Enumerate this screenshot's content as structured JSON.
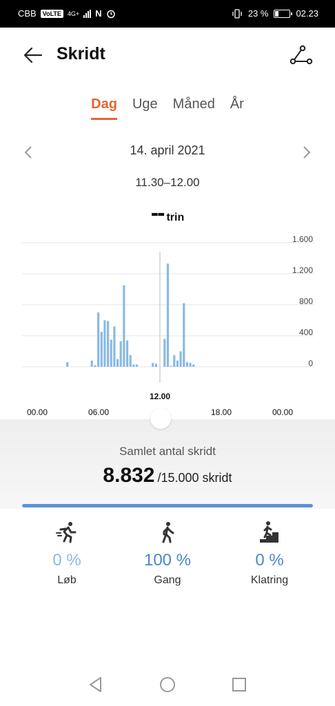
{
  "status_bar": {
    "carrier": "CBB",
    "volte": "VoLTE",
    "network": "4G+",
    "nfc": "N",
    "battery_pct": "23 %",
    "time": "02.23"
  },
  "header": {
    "title": "Skridt",
    "back_icon": "arrow-left-icon",
    "share_icon": "share-nodes-icon"
  },
  "tabs": [
    {
      "label": "Dag",
      "active": true
    },
    {
      "label": "Uge",
      "active": false
    },
    {
      "label": "Måned",
      "active": false
    },
    {
      "label": "År",
      "active": false
    }
  ],
  "date": "14. april 2021",
  "time_range": "11.30–12.00",
  "selected_steps": "--",
  "steps_unit": "trin",
  "chart_data": {
    "type": "bar",
    "x_ticks": [
      "00.00",
      "06.00",
      "18.00",
      "00.00"
    ],
    "selected_tick": "12.00",
    "y_ticks": [
      "1.600",
      "1.200",
      "800",
      "400",
      "0"
    ],
    "ylim": [
      0,
      1600
    ],
    "bar_color": "#8ab9e6",
    "x_hours": [
      2.5,
      4.0,
      4.3,
      4.6,
      4.9,
      5.2,
      5.5,
      5.8,
      6.1,
      6.4,
      6.7,
      7.0,
      7.3,
      7.6,
      8.0,
      8.4,
      8.8,
      9.2,
      9.6,
      10.0,
      10.3,
      10.6,
      11.0,
      11.4,
      11.8,
      12.2,
      12.6,
      13.0,
      13.4,
      13.8,
      14.2,
      14.6,
      15.0,
      15.4,
      15.8,
      16.2,
      16.6,
      17.0,
      17.4,
      17.8,
      18.2,
      18.6,
      19.0
    ],
    "values": [
      60,
      0,
      0,
      0,
      0,
      0,
      0,
      0,
      0,
      0,
      0,
      0,
      0,
      0,
      80,
      20,
      700,
      450,
      600,
      590,
      350,
      520,
      100,
      330,
      1050,
      340,
      150,
      30,
      30,
      0,
      0,
      0,
      50,
      40,
      0,
      360,
      1330,
      10,
      150,
      80,
      200,
      820,
      60
    ],
    "bars": [
      {
        "h": 3.2,
        "v": 60
      },
      {
        "h": 5.5,
        "v": 80
      },
      {
        "h": 5.8,
        "v": 20
      },
      {
        "h": 6.1,
        "v": 700
      },
      {
        "h": 6.4,
        "v": 450
      },
      {
        "h": 6.7,
        "v": 600
      },
      {
        "h": 7.0,
        "v": 590
      },
      {
        "h": 7.3,
        "v": 350
      },
      {
        "h": 7.6,
        "v": 520
      },
      {
        "h": 7.9,
        "v": 100
      },
      {
        "h": 8.2,
        "v": 330
      },
      {
        "h": 8.5,
        "v": 1050
      },
      {
        "h": 8.8,
        "v": 340
      },
      {
        "h": 9.1,
        "v": 150
      },
      {
        "h": 9.4,
        "v": 30
      },
      {
        "h": 9.7,
        "v": 30
      },
      {
        "h": 11.2,
        "v": 50
      },
      {
        "h": 11.5,
        "v": 40
      },
      {
        "h": 12.3,
        "v": 360
      },
      {
        "h": 12.6,
        "v": 1330
      },
      {
        "h": 12.9,
        "v": 10
      },
      {
        "h": 13.2,
        "v": 150
      },
      {
        "h": 13.5,
        "v": 80
      },
      {
        "h": 13.8,
        "v": 200
      },
      {
        "h": 14.1,
        "v": 820
      },
      {
        "h": 14.4,
        "v": 60
      },
      {
        "h": 14.7,
        "v": 50
      },
      {
        "h": 15.0,
        "v": 30
      }
    ]
  },
  "total": {
    "label": "Samlet antal skridt",
    "value": "8.832",
    "goal": "/15.000 skridt",
    "progress": 1.0,
    "progress_color": "#5b93d8"
  },
  "activities": [
    {
      "icon": "running-icon",
      "pct": "0 %",
      "label": "Løb",
      "color": "#8ab9e6"
    },
    {
      "icon": "walking-icon",
      "pct": "100 %",
      "label": "Gang",
      "color": "#4a86d1"
    },
    {
      "icon": "climbing-icon",
      "pct": "0 %",
      "label": "Klatring",
      "color": "#4a86d1"
    }
  ],
  "nav": {
    "back_icon": "triangle-back-icon",
    "home_icon": "circle-home-icon",
    "recents_icon": "square-recents-icon"
  }
}
